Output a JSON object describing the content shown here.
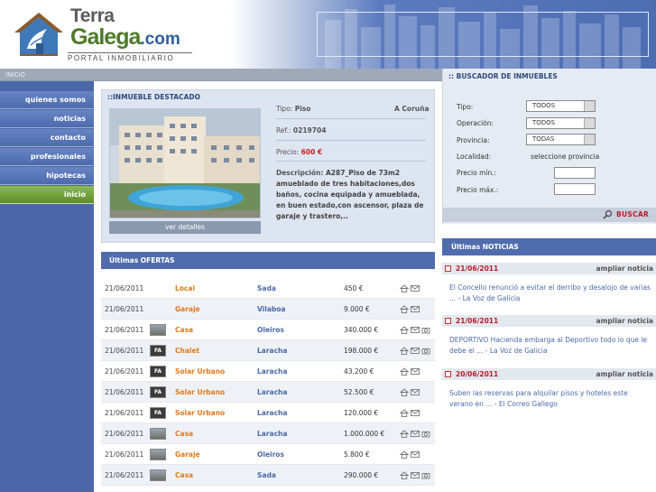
{
  "logo": {
    "word1": "Terra",
    "word2": "Galega",
    "domain": ".com",
    "tagline": "PORTAL INMOBILIARIO"
  },
  "breadcrumb": "INICIO",
  "nav": [
    {
      "label": "quienes somos"
    },
    {
      "label": "noticias"
    },
    {
      "label": "contacto"
    },
    {
      "label": "profesionales"
    },
    {
      "label": "hipotecas"
    },
    {
      "label": "inicio",
      "active": true
    }
  ],
  "featured": {
    "title": "::INMUEBLE DESTACADO",
    "tipo_label": "Tipo:",
    "tipo": "Piso",
    "location": "A Coruña",
    "ref_label": "Ref.:",
    "ref": "0219704",
    "precio_label": "Precio:",
    "precio": "600 €",
    "desc_label": "Descripción:",
    "desc": "A287_Piso de 73m2 amueblado de tres habitaciones,dos baños, cocina equipada y amueblada, en buen estado,con ascensor, plaza de garaje y trastero,..",
    "ver_label": "ver detalles"
  },
  "ofertas": {
    "title": "Últimas OFERTAS",
    "rows": [
      {
        "date": "21/06/2011",
        "thumb": "",
        "type": "Local",
        "city": "Sada",
        "price": "450 €"
      },
      {
        "date": "21/06/2011",
        "thumb": "",
        "type": "Garaje",
        "city": "Vilaboa",
        "price": "9.000 €"
      },
      {
        "date": "21/06/2011",
        "thumb": "photo",
        "type": "Casa",
        "city": "Oleiros",
        "price": "340.000 €"
      },
      {
        "date": "21/06/2011",
        "thumb": "FA",
        "type": "Chalet",
        "city": "Laracha",
        "price": "198.000 €"
      },
      {
        "date": "21/06/2011",
        "thumb": "FA",
        "type": "Solar Urbano",
        "city": "Laracha",
        "price": "43.200 €"
      },
      {
        "date": "21/06/2011",
        "thumb": "FA",
        "type": "Solar Urbano",
        "city": "Laracha",
        "price": "52.500 €"
      },
      {
        "date": "21/06/2011",
        "thumb": "FA",
        "type": "Solar Urbano",
        "city": "Laracha",
        "price": "120.000 €"
      },
      {
        "date": "21/06/2011",
        "thumb": "photo",
        "type": "Casa",
        "city": "Laracha",
        "price": "1.000.000 €"
      },
      {
        "date": "21/06/2011",
        "thumb": "photo",
        "type": "Garaje",
        "city": "Oleiros",
        "price": "5.800 €"
      },
      {
        "date": "21/06/2011",
        "thumb": "photo",
        "type": "Casa",
        "city": "Sada",
        "price": "290.000 €"
      }
    ]
  },
  "search": {
    "title": ":: BUSCADOR DE INMUEBLES",
    "tipo_label": "Tipo:",
    "tipo_value": "TODOS",
    "operacion_label": "Operación:",
    "operacion_value": "TODOS",
    "provincia_label": "Provincia:",
    "provincia_value": "TODAS",
    "localidad_label": "Localidad:",
    "localidad_value": "seleccione provincia",
    "precio_min_label": "Precio mín.:",
    "precio_max_label": "Precio máx.:",
    "buscar_label": "BUSCAR"
  },
  "noticias": {
    "title": "Últimas NOTICIAS",
    "items": [
      {
        "date": "21/06/2011",
        "more": "ampliar noticia",
        "text": "El Concello renunció a evitar el derribo y desalojo de varias ... - La Voz de Galicia"
      },
      {
        "date": "21/06/2011",
        "more": "ampliar noticia",
        "text": "DEPORTIVO Hacienda embarga al Deportivo todo lo que le debe el ... - La Voz de Galicia"
      },
      {
        "date": "20/06/2011",
        "more": "ampliar noticia",
        "text": "Suben las reservas para alquilar pisos y hoteles este verano en ... - El Correo Gallego"
      }
    ]
  }
}
